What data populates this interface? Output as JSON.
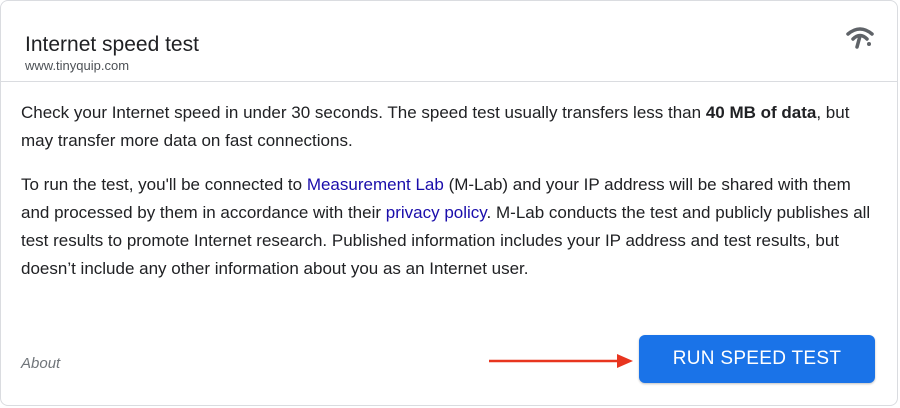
{
  "header": {
    "title": "Internet speed test",
    "url": "www.tinyquip.com",
    "icon": "wifi-icon"
  },
  "body": {
    "p1_text1": "Check your Internet speed in under 30 seconds. The speed test usually transfers less than ",
    "p1_bold": "40 MB of data",
    "p1_text2": ", but may transfer more data on fast connections.",
    "p2_text1": "To run the test, you'll be connected to ",
    "p2_link1": "Measurement Lab",
    "p2_text2": " (M-Lab) and your IP address will be shared with them and processed by them in accordance with their ",
    "p2_link2": "privacy policy",
    "p2_text3": ". M-Lab conducts the test and publicly publishes all test results to promote Internet research. Published information includes your IP address and test results, but doesn’t include any other information about you as an Internet user."
  },
  "footer": {
    "about_label": "About",
    "run_button_label": "RUN SPEED TEST",
    "arrow_icon": "right-arrow-icon"
  },
  "colors": {
    "accent": "#1a73e8",
    "link": "#1a0dab",
    "arrow": "#e8351f"
  }
}
